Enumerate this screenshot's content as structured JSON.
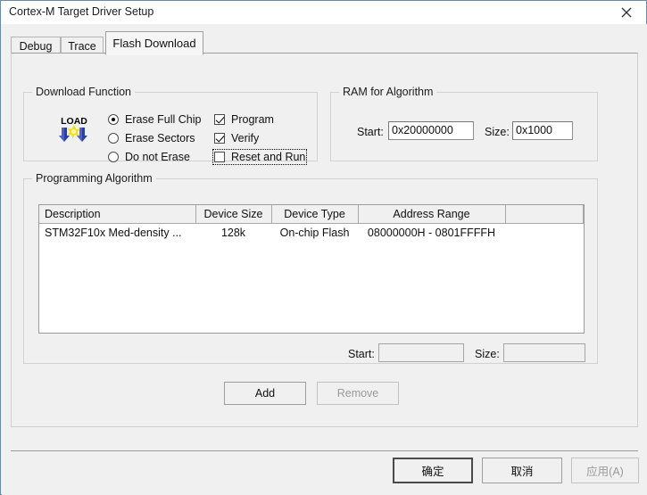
{
  "window": {
    "title": "Cortex-M Target Driver Setup",
    "close_icon": "close-icon"
  },
  "tabs": [
    {
      "label": "Debug",
      "active": false
    },
    {
      "label": "Trace",
      "active": false
    },
    {
      "label": "Flash Download",
      "active": true
    }
  ],
  "download_function": {
    "title": "Download Function",
    "icon": "load-icon",
    "icon_text": "LOAD",
    "radios": [
      {
        "label": "Erase Full Chip",
        "checked": true
      },
      {
        "label": "Erase Sectors",
        "checked": false
      },
      {
        "label": "Do not Erase",
        "checked": false
      }
    ],
    "checkboxes": [
      {
        "label": "Program",
        "checked": true,
        "focused": false
      },
      {
        "label": "Verify",
        "checked": true,
        "focused": false
      },
      {
        "label": "Reset and Run",
        "checked": false,
        "focused": true
      }
    ]
  },
  "ram_for_algorithm": {
    "title": "RAM for Algorithm",
    "start_label": "Start:",
    "start_value": "0x20000000",
    "size_label": "Size:",
    "size_value": "0x1000"
  },
  "programming_algorithm": {
    "title": "Programming Algorithm",
    "columns": [
      "Description",
      "Device Size",
      "Device Type",
      "Address Range",
      ""
    ],
    "rows": [
      {
        "description": "STM32F10x Med-density ...",
        "device_size": "128k",
        "device_type": "On-chip Flash",
        "address_range": "08000000H - 0801FFFFH",
        "extra": ""
      }
    ],
    "start_label": "Start:",
    "start_value": "",
    "size_label": "Size:",
    "size_value": "",
    "add_label": "Add",
    "remove_label": "Remove"
  },
  "footer": {
    "ok_label": "确定",
    "cancel_label": "取消",
    "apply_label": "应用(A)"
  },
  "colors": {
    "window_border": "#6b89a8",
    "dialog_bg": "#f0f0f0",
    "titlebar_bg": "#ffffff",
    "field_bg": "#ffffff",
    "disabled_text": "#9a9a9a"
  }
}
